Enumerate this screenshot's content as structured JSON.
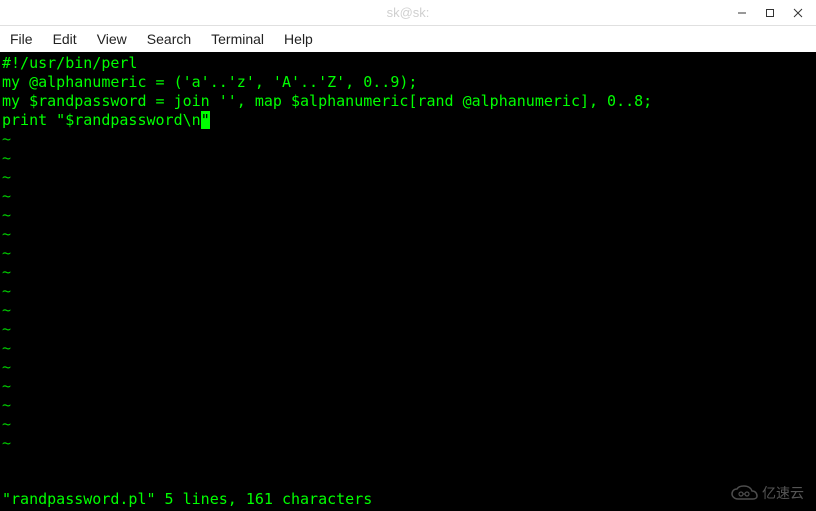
{
  "titlebar": {
    "title": "sk@sk:"
  },
  "menubar": {
    "items": [
      "File",
      "Edit",
      "View",
      "Search",
      "Terminal",
      "Help"
    ]
  },
  "editor": {
    "lines": [
      "#!/usr/bin/perl",
      "",
      "my @alphanumeric = ('a'..'z', 'A'..'Z', 0..9);",
      "my $randpassword = join '', map $alphanumeric[rand @alphanumeric], 0..8;",
      "print \"$randpassword\\n"
    ],
    "cursor_char": "\"",
    "tilde": "~",
    "tilde_count": 17,
    "status": "\"randpassword.pl\" 5 lines, 161 characters"
  },
  "watermark": {
    "text": "亿速云"
  }
}
